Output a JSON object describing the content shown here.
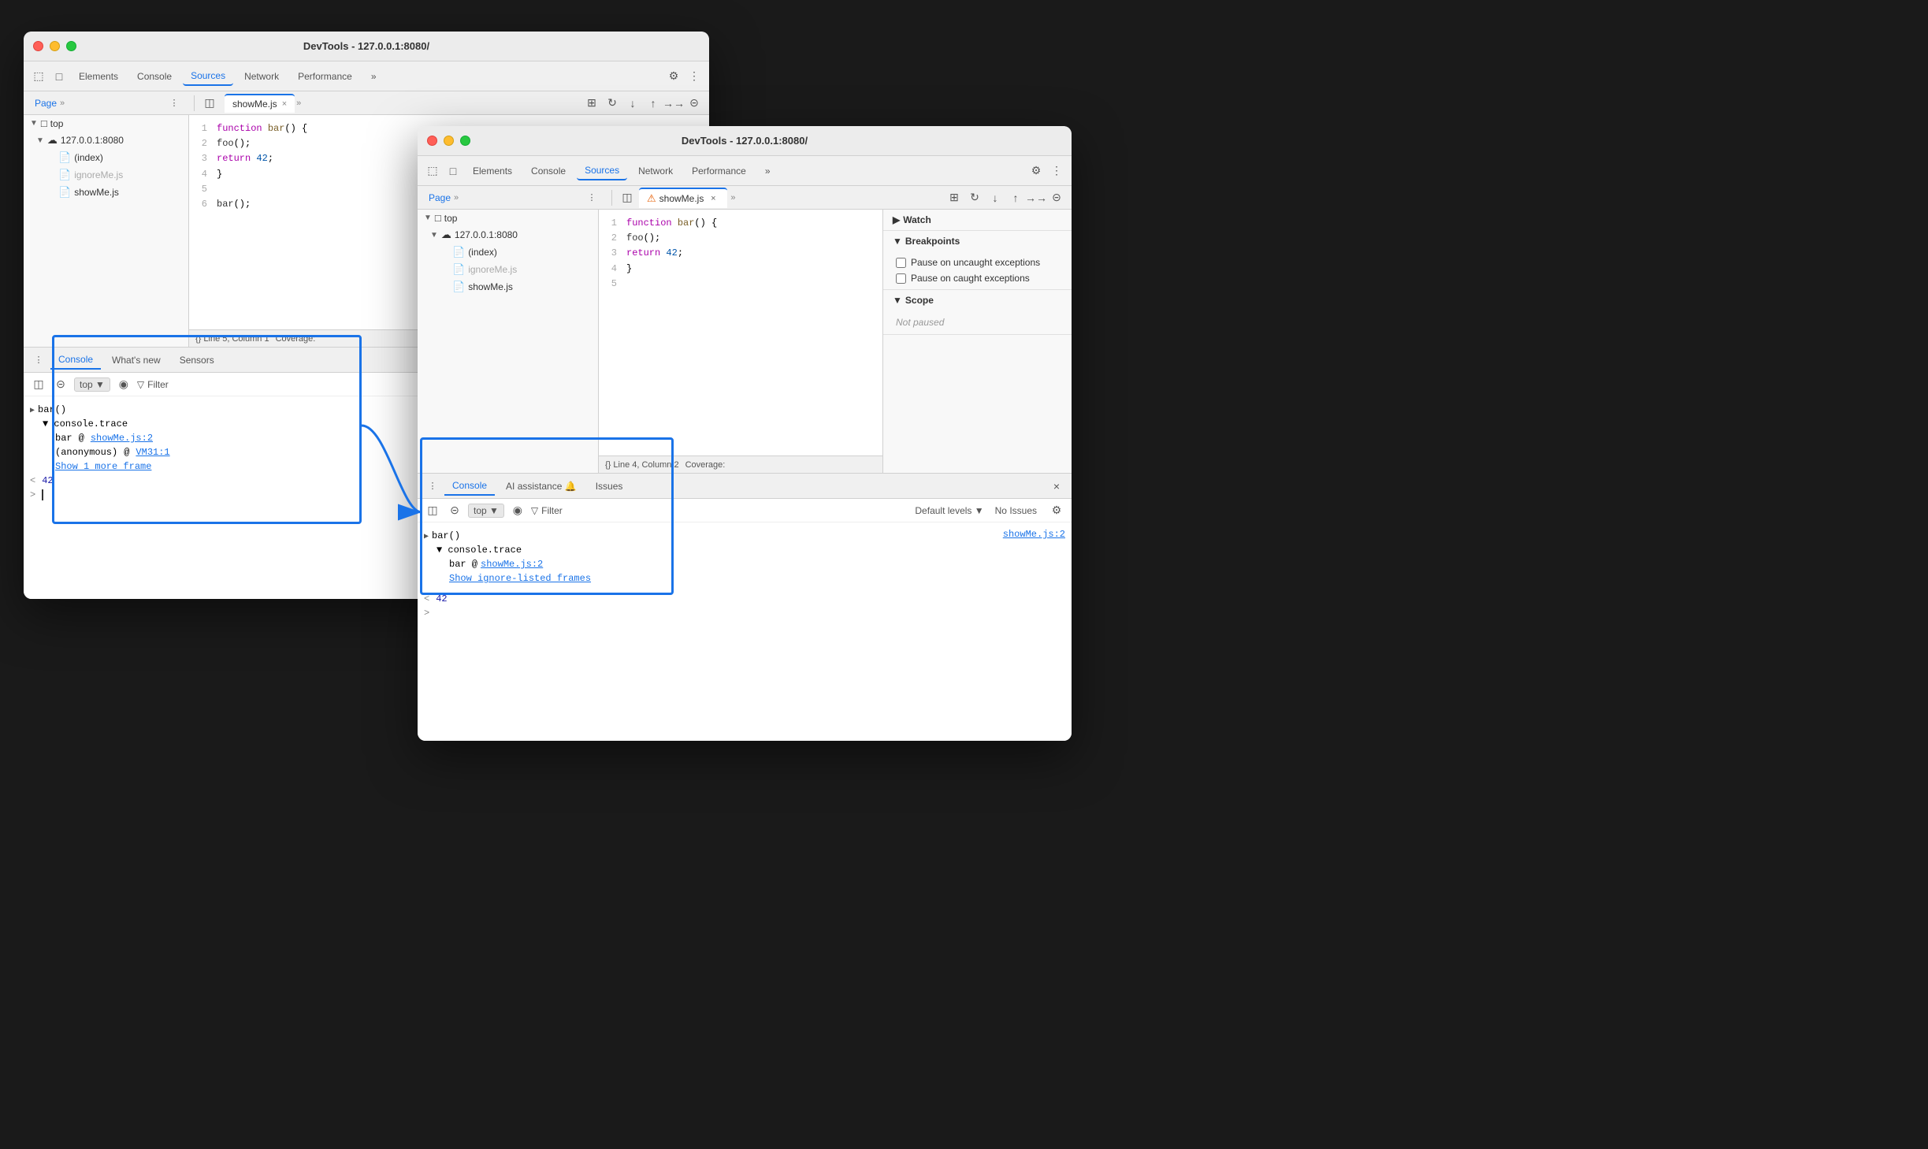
{
  "window_back": {
    "title": "DevTools - 127.0.0.1:8080/",
    "tabs": {
      "main": [
        "Elements",
        "Console",
        "Sources",
        "Network",
        "Performance"
      ],
      "active_main": "Sources",
      "sidebar_label": "Page",
      "file_tabs": [
        "showMe.js"
      ],
      "active_file": "showMe.js"
    },
    "sidebar": {
      "items": [
        {
          "label": "top",
          "indent": 0,
          "type": "frame"
        },
        {
          "label": "127.0.0.1:8080",
          "indent": 1,
          "type": "server"
        },
        {
          "label": "(index)",
          "indent": 2,
          "type": "file"
        },
        {
          "label": "ignoreMe.js",
          "indent": 2,
          "type": "file-warn"
        },
        {
          "label": "showMe.js",
          "indent": 2,
          "type": "file-warn"
        }
      ]
    },
    "code": {
      "lines": [
        {
          "num": 1,
          "text": "function bar() {"
        },
        {
          "num": 2,
          "text": "  foo();"
        },
        {
          "num": 3,
          "text": "  return 42;"
        },
        {
          "num": 4,
          "text": "}"
        },
        {
          "num": 5,
          "text": ""
        },
        {
          "num": 6,
          "text": "bar();"
        }
      ],
      "statusbar": "Line 5, Column 1",
      "statusbar2": "Coverage:"
    },
    "bottom": {
      "tabs": [
        "Console",
        "What's new",
        "Sensors"
      ],
      "active_tab": "Console",
      "toolbar": {
        "top_label": "top",
        "filter_placeholder": "Filter"
      },
      "entries": [
        {
          "type": "group",
          "label": "> bar()"
        },
        {
          "type": "trace-header",
          "label": "▼ console.trace"
        },
        {
          "type": "trace-item",
          "label": "bar",
          "at": "@ ",
          "link": "showMe.js:2"
        },
        {
          "type": "trace-item",
          "label": "(anonymous)",
          "at": "@ ",
          "link": "VM31:1"
        },
        {
          "type": "link",
          "label": "Show 1 more frame"
        },
        {
          "type": "value",
          "label": "< 42"
        },
        {
          "type": "prompt",
          "label": "> "
        }
      ]
    }
  },
  "window_front": {
    "title": "DevTools - 127.0.0.1:8080/",
    "tabs": {
      "main": [
        "Elements",
        "Console",
        "Sources",
        "Network",
        "Performance"
      ],
      "active_main": "Sources",
      "sidebar_label": "Page",
      "file_tabs": [
        "showMe.js"
      ],
      "active_file": "showMe.js",
      "file_warning": true
    },
    "sidebar": {
      "items": [
        {
          "label": "top",
          "indent": 0,
          "type": "frame"
        },
        {
          "label": "127.0.0.1:8080",
          "indent": 1,
          "type": "server"
        },
        {
          "label": "(index)",
          "indent": 2,
          "type": "file"
        },
        {
          "label": "ignoreMe.js",
          "indent": 2,
          "type": "file-warn"
        },
        {
          "label": "showMe.js",
          "indent": 2,
          "type": "file-warn"
        }
      ]
    },
    "code": {
      "lines": [
        {
          "num": 1,
          "text": "function bar() {"
        },
        {
          "num": 2,
          "text": "  foo();"
        },
        {
          "num": 3,
          "text": "  return 42;"
        },
        {
          "num": 4,
          "text": "}"
        },
        {
          "num": 5,
          "text": ""
        }
      ],
      "statusbar": "Line 4, Column 2",
      "statusbar2": "Coverage:"
    },
    "right_panel": {
      "sections": [
        {
          "label": "Watch",
          "collapsed": true
        },
        {
          "label": "Breakpoints",
          "collapsed": false
        },
        {
          "label": "Scope",
          "collapsed": false
        }
      ],
      "breakpoints": {
        "pause_uncaught": "Pause on uncaught exceptions",
        "pause_caught": "Pause on caught exceptions"
      },
      "scope_status": "Not paused"
    },
    "bottom": {
      "tabs": [
        "Console",
        "AI assistance 🔔",
        "Issues"
      ],
      "active_tab": "Console",
      "close_label": "×",
      "toolbar": {
        "top_label": "top",
        "filter_placeholder": "Filter",
        "levels_label": "Default levels",
        "no_issues_label": "No Issues"
      },
      "entries": [
        {
          "type": "group",
          "label": "> bar()"
        },
        {
          "type": "trace-header",
          "label": "▼ console.trace"
        },
        {
          "type": "trace-item-front",
          "label": "bar @ ",
          "link": "showMe.js:2"
        },
        {
          "type": "link",
          "label": "Show ignore-listed frames"
        },
        {
          "type": "value",
          "label": "< 42"
        },
        {
          "type": "prompt",
          "label": ">"
        }
      ],
      "side_link": "showMe.js:2"
    }
  },
  "icons": {
    "elements": "⬚",
    "console": "⊡",
    "more": "»",
    "settings": "⚙",
    "menu": "⋮",
    "inspect": "⬚",
    "device": "□",
    "cursor": "⊹",
    "search": "⌕",
    "deactivate": "⊝",
    "eye": "◉",
    "filter": "▽",
    "chevron_right": "▶",
    "chevron_down": "▼",
    "triangle": "▸",
    "close": "×"
  }
}
